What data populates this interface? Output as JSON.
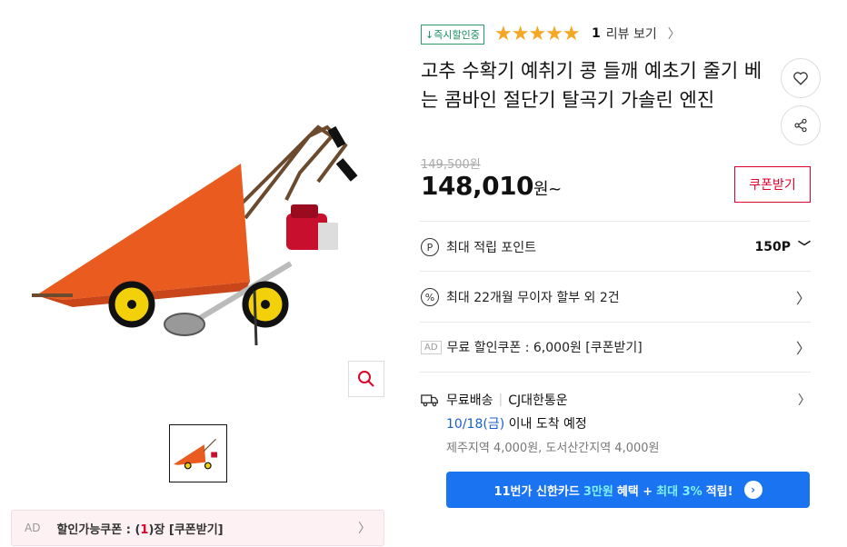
{
  "badge": "↓즉시할인중",
  "stars": "★★★★★",
  "rating": {
    "count": "1",
    "label": "리뷰 보기",
    "chevron": "〉"
  },
  "title": "고추 수확기 예취기 콩 들깨 예초기 줄기 베는 콤바인 절단기 탈곡기 가솔린 엔진",
  "original_price": "149,500원",
  "price": {
    "amount": "148,010",
    "unit": "원~"
  },
  "coupon_button": "쿠폰받기",
  "points": {
    "label": "최대 적립 포인트",
    "value": "150P",
    "icon": "P"
  },
  "installment": {
    "label": "최대 22개월 무이자 할부 외 2건",
    "icon": "%"
  },
  "ad_coupon_row": {
    "ad": "AD",
    "label": "무료 할인쿠폰 : 6,000원 [쿠폰받기]"
  },
  "delivery": {
    "type": "무료배송",
    "carrier": "CJ대한통운",
    "date": "10/18(금)",
    "date_suffix": "이내 도착 예정",
    "extra": "제주지역 4,000원, 도서산간지역 4,000원"
  },
  "banner": {
    "part1": "11번가 신한카드",
    "hl1": "3만원",
    "part2": "혜택 +",
    "hl2": "최대 3%",
    "part3": "적립!"
  },
  "left_ad": {
    "ad": "AD",
    "label_prefix": "할인가능쿠폰 : (",
    "count": "1",
    "label_suffix": ")장 [쿠폰받기]"
  },
  "colors": {
    "accent_red": "#e0002a",
    "blue": "#1a73f0",
    "green": "#148e5b",
    "star": "#f5a623"
  }
}
